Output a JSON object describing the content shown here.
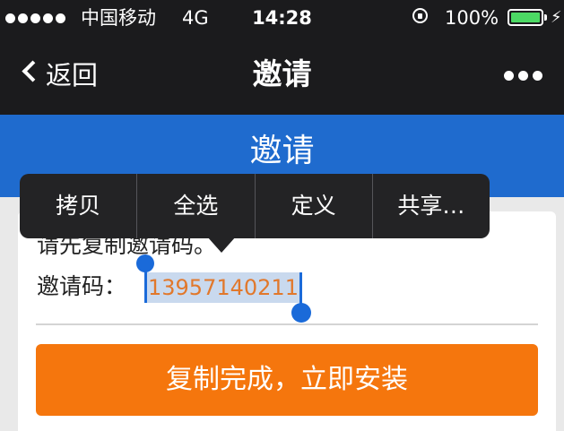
{
  "status_bar": {
    "carrier": "中国移动",
    "network": "4G",
    "time": "14:28",
    "battery_percent": "100%",
    "icons": [
      "signal-dots-icon",
      "rotation-lock-icon",
      "battery-icon",
      "charging-icon"
    ]
  },
  "nav_bar": {
    "back_label": "返回",
    "title": "邀请",
    "more_icon": "more-dots-icon"
  },
  "page": {
    "heading": "邀请",
    "instruction": "请先复制邀请码。",
    "code_label": "邀请码：",
    "code_value": "13957140211",
    "install_button_label": "复制完成，立即安装"
  },
  "edit_menu": {
    "items": [
      {
        "label": "拷贝"
      },
      {
        "label": "全选"
      },
      {
        "label": "定义"
      },
      {
        "label": "共享…"
      }
    ]
  },
  "colors": {
    "status_bar_bg": "#1b1b1d",
    "banner_blue": "#1f6bce",
    "button_orange": "#f5760d",
    "code_orange": "#e1782c",
    "selection_blue": "#1a6ad9",
    "battery_green": "#4cd964"
  }
}
